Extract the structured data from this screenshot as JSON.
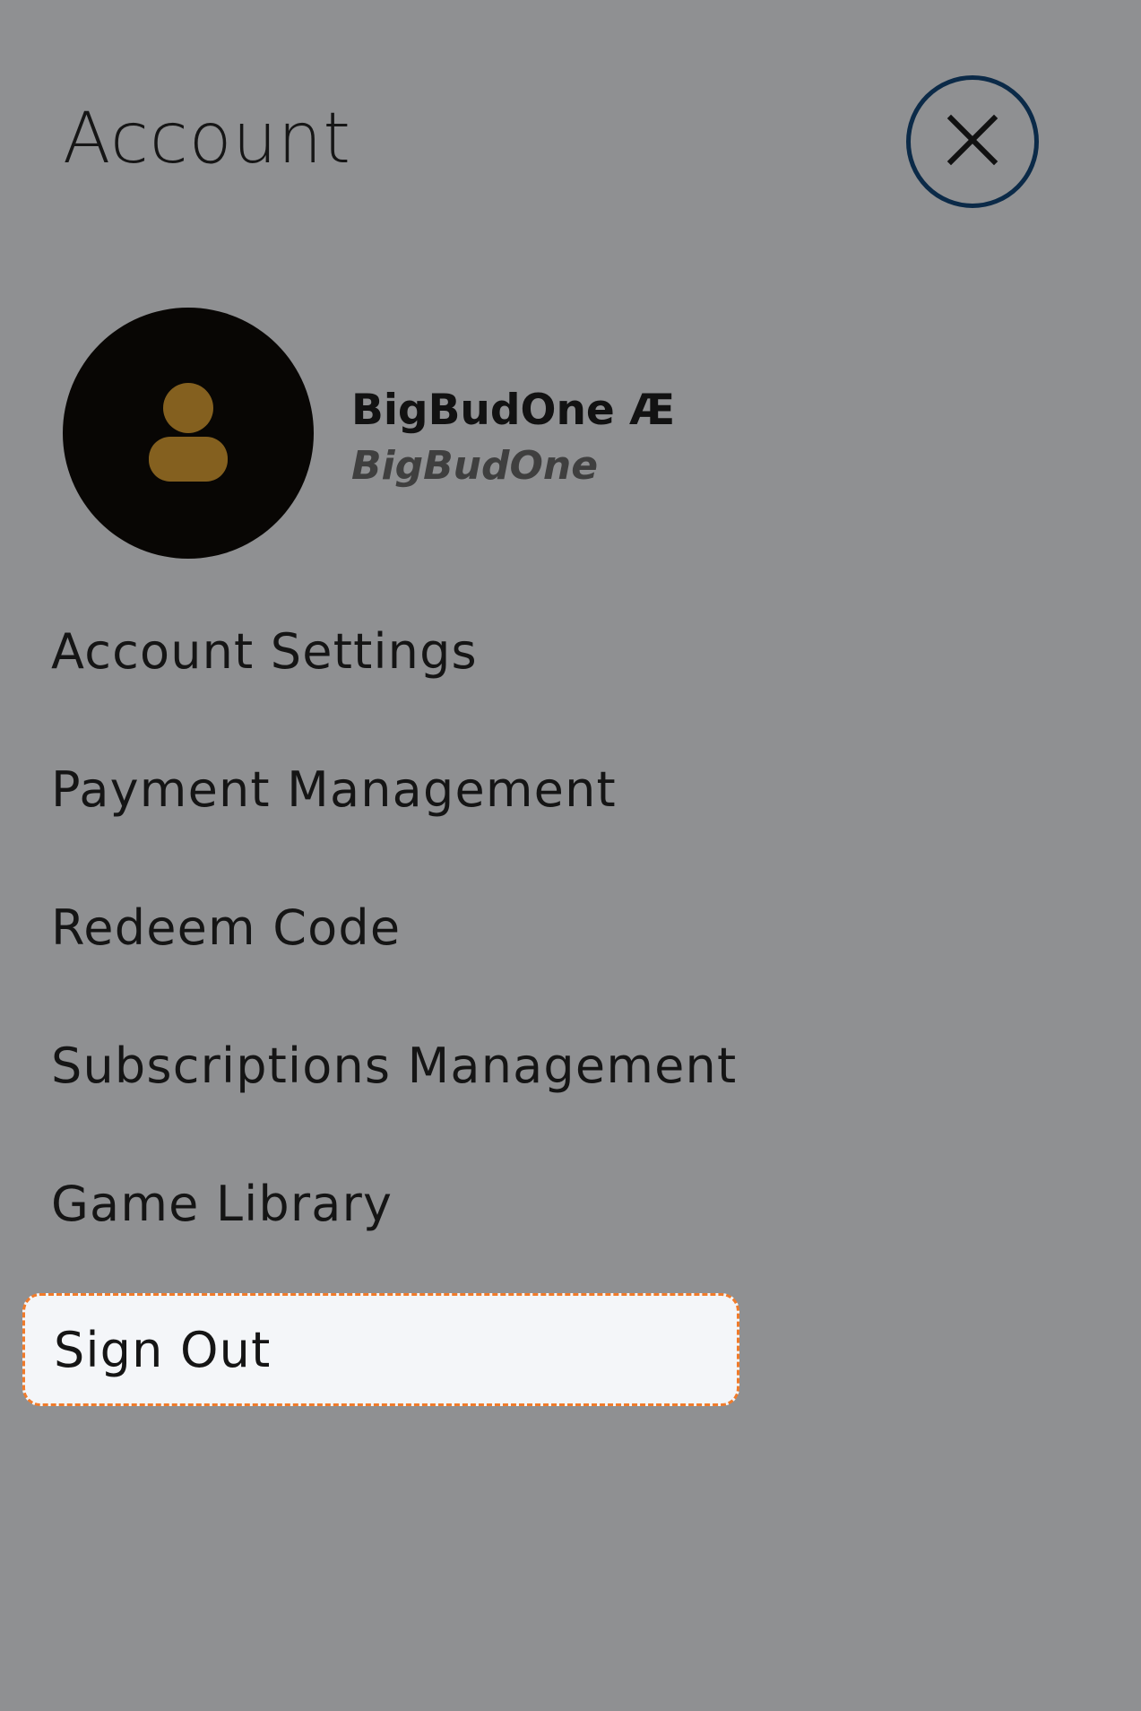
{
  "header": {
    "title": "Account",
    "close_icon": "close-icon"
  },
  "profile": {
    "avatar_icon": "user-icon",
    "display_name": "BigBudOne Æ",
    "online_id": "BigBudOne",
    "colors": {
      "avatar_background": "#080604",
      "avatar_icon": "#84601f"
    }
  },
  "menu": {
    "items": [
      {
        "label": "Account Settings"
      },
      {
        "label": "Payment Management"
      },
      {
        "label": "Redeem Code"
      },
      {
        "label": "Subscriptions Management"
      },
      {
        "label": "Game Library"
      },
      {
        "label": "Sign Out"
      }
    ],
    "selected": "Sign Out"
  },
  "colors": {
    "background": "#8f9092",
    "focus_border": "#f07b2b",
    "selected_background": "#f4f6f9",
    "close_border": "#0b2a48"
  }
}
